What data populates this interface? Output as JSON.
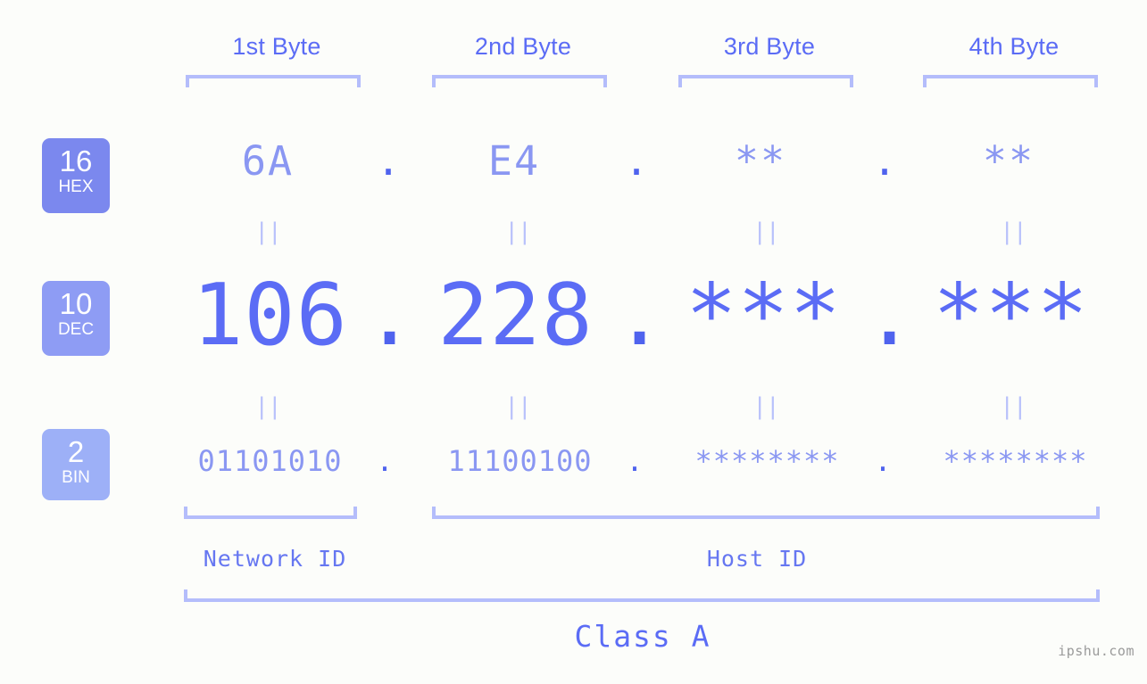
{
  "page": {
    "watermark": "ipshu.com",
    "background_color": "#fcfdfa",
    "accent_color": "#5b6cf5",
    "light_accent_color": "#b4bdfb"
  },
  "byte_headers": [
    {
      "label": "1st Byte"
    },
    {
      "label": "2nd Byte"
    },
    {
      "label": "3rd Byte"
    },
    {
      "label": "4th Byte"
    }
  ],
  "bases": [
    {
      "number": "16",
      "abbr": "HEX",
      "color": "#7b88ee"
    },
    {
      "number": "10",
      "abbr": "DEC",
      "color": "#8e9cf4"
    },
    {
      "number": "2",
      "abbr": "BIN",
      "color": "#9db0f7"
    }
  ],
  "separators": {
    "dot": ".",
    "equals": "||"
  },
  "rows": {
    "hex": {
      "base_label": "HEX",
      "values": [
        "6A",
        "E4",
        "**",
        "**"
      ]
    },
    "dec": {
      "base_label": "DEC",
      "values": [
        "106",
        "228",
        "***",
        "***"
      ]
    },
    "bin": {
      "base_label": "BIN",
      "values": [
        "01101010",
        "11100100",
        "********",
        "********"
      ]
    }
  },
  "sections": {
    "network_id": "Network ID",
    "host_id": "Host ID",
    "class": "Class A"
  }
}
